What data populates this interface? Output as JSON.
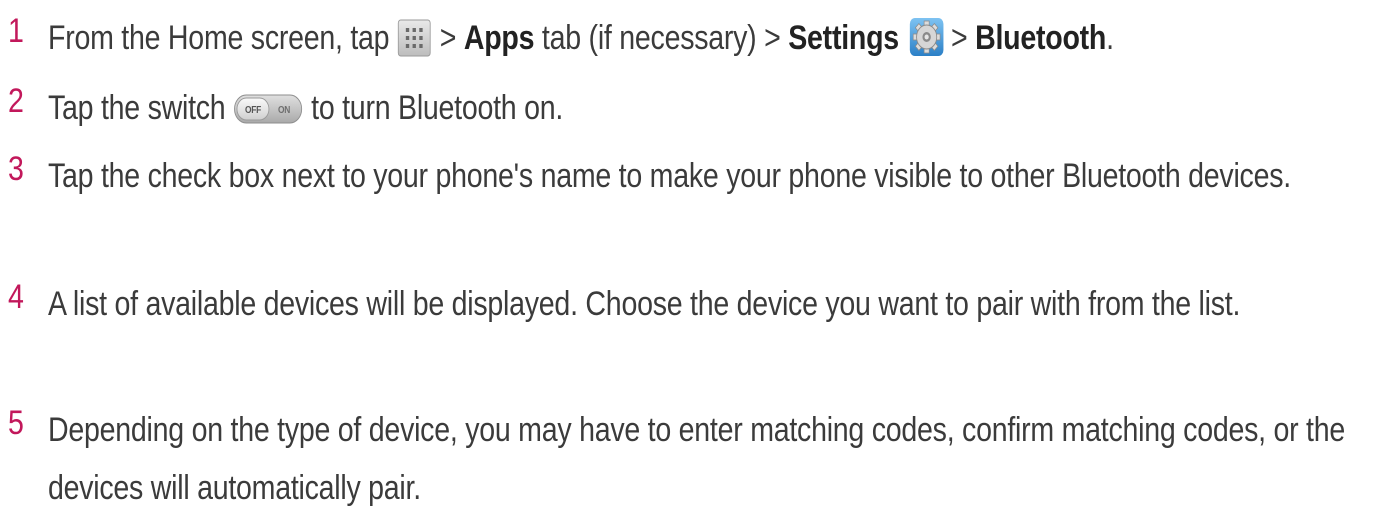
{
  "steps": [
    {
      "number": "1",
      "parts": {
        "p1": "From the Home screen, tap",
        "p2": ">",
        "apps": "Apps",
        "p3": "tab (if necessary) >",
        "settings": "Settings",
        "p4": ">",
        "bluetooth": "Bluetooth",
        "p5": "."
      },
      "icons": [
        "apps-grid-icon",
        "settings-gear-icon"
      ]
    },
    {
      "number": "2",
      "parts": {
        "p1": "Tap the switch",
        "p2": "to turn Bluetooth on."
      },
      "switch": {
        "off_label": "OFF",
        "on_label": "ON"
      },
      "icons": [
        "off-on-switch-icon"
      ]
    },
    {
      "number": "3",
      "text": "Tap the check box next to your phone's name to make your phone visible to other Bluetooth devices."
    },
    {
      "number": "4",
      "text": "A list of available devices will be displayed. Choose the device you want to pair with from the list."
    },
    {
      "number": "5",
      "text": "Depending on the type of device, you may have to enter matching codes, confirm matching codes, or the devices will automatically pair."
    }
  ],
  "colors": {
    "step_number": "#c2185b",
    "body_text": "#3b3b3b",
    "bold_text": "#222222"
  }
}
